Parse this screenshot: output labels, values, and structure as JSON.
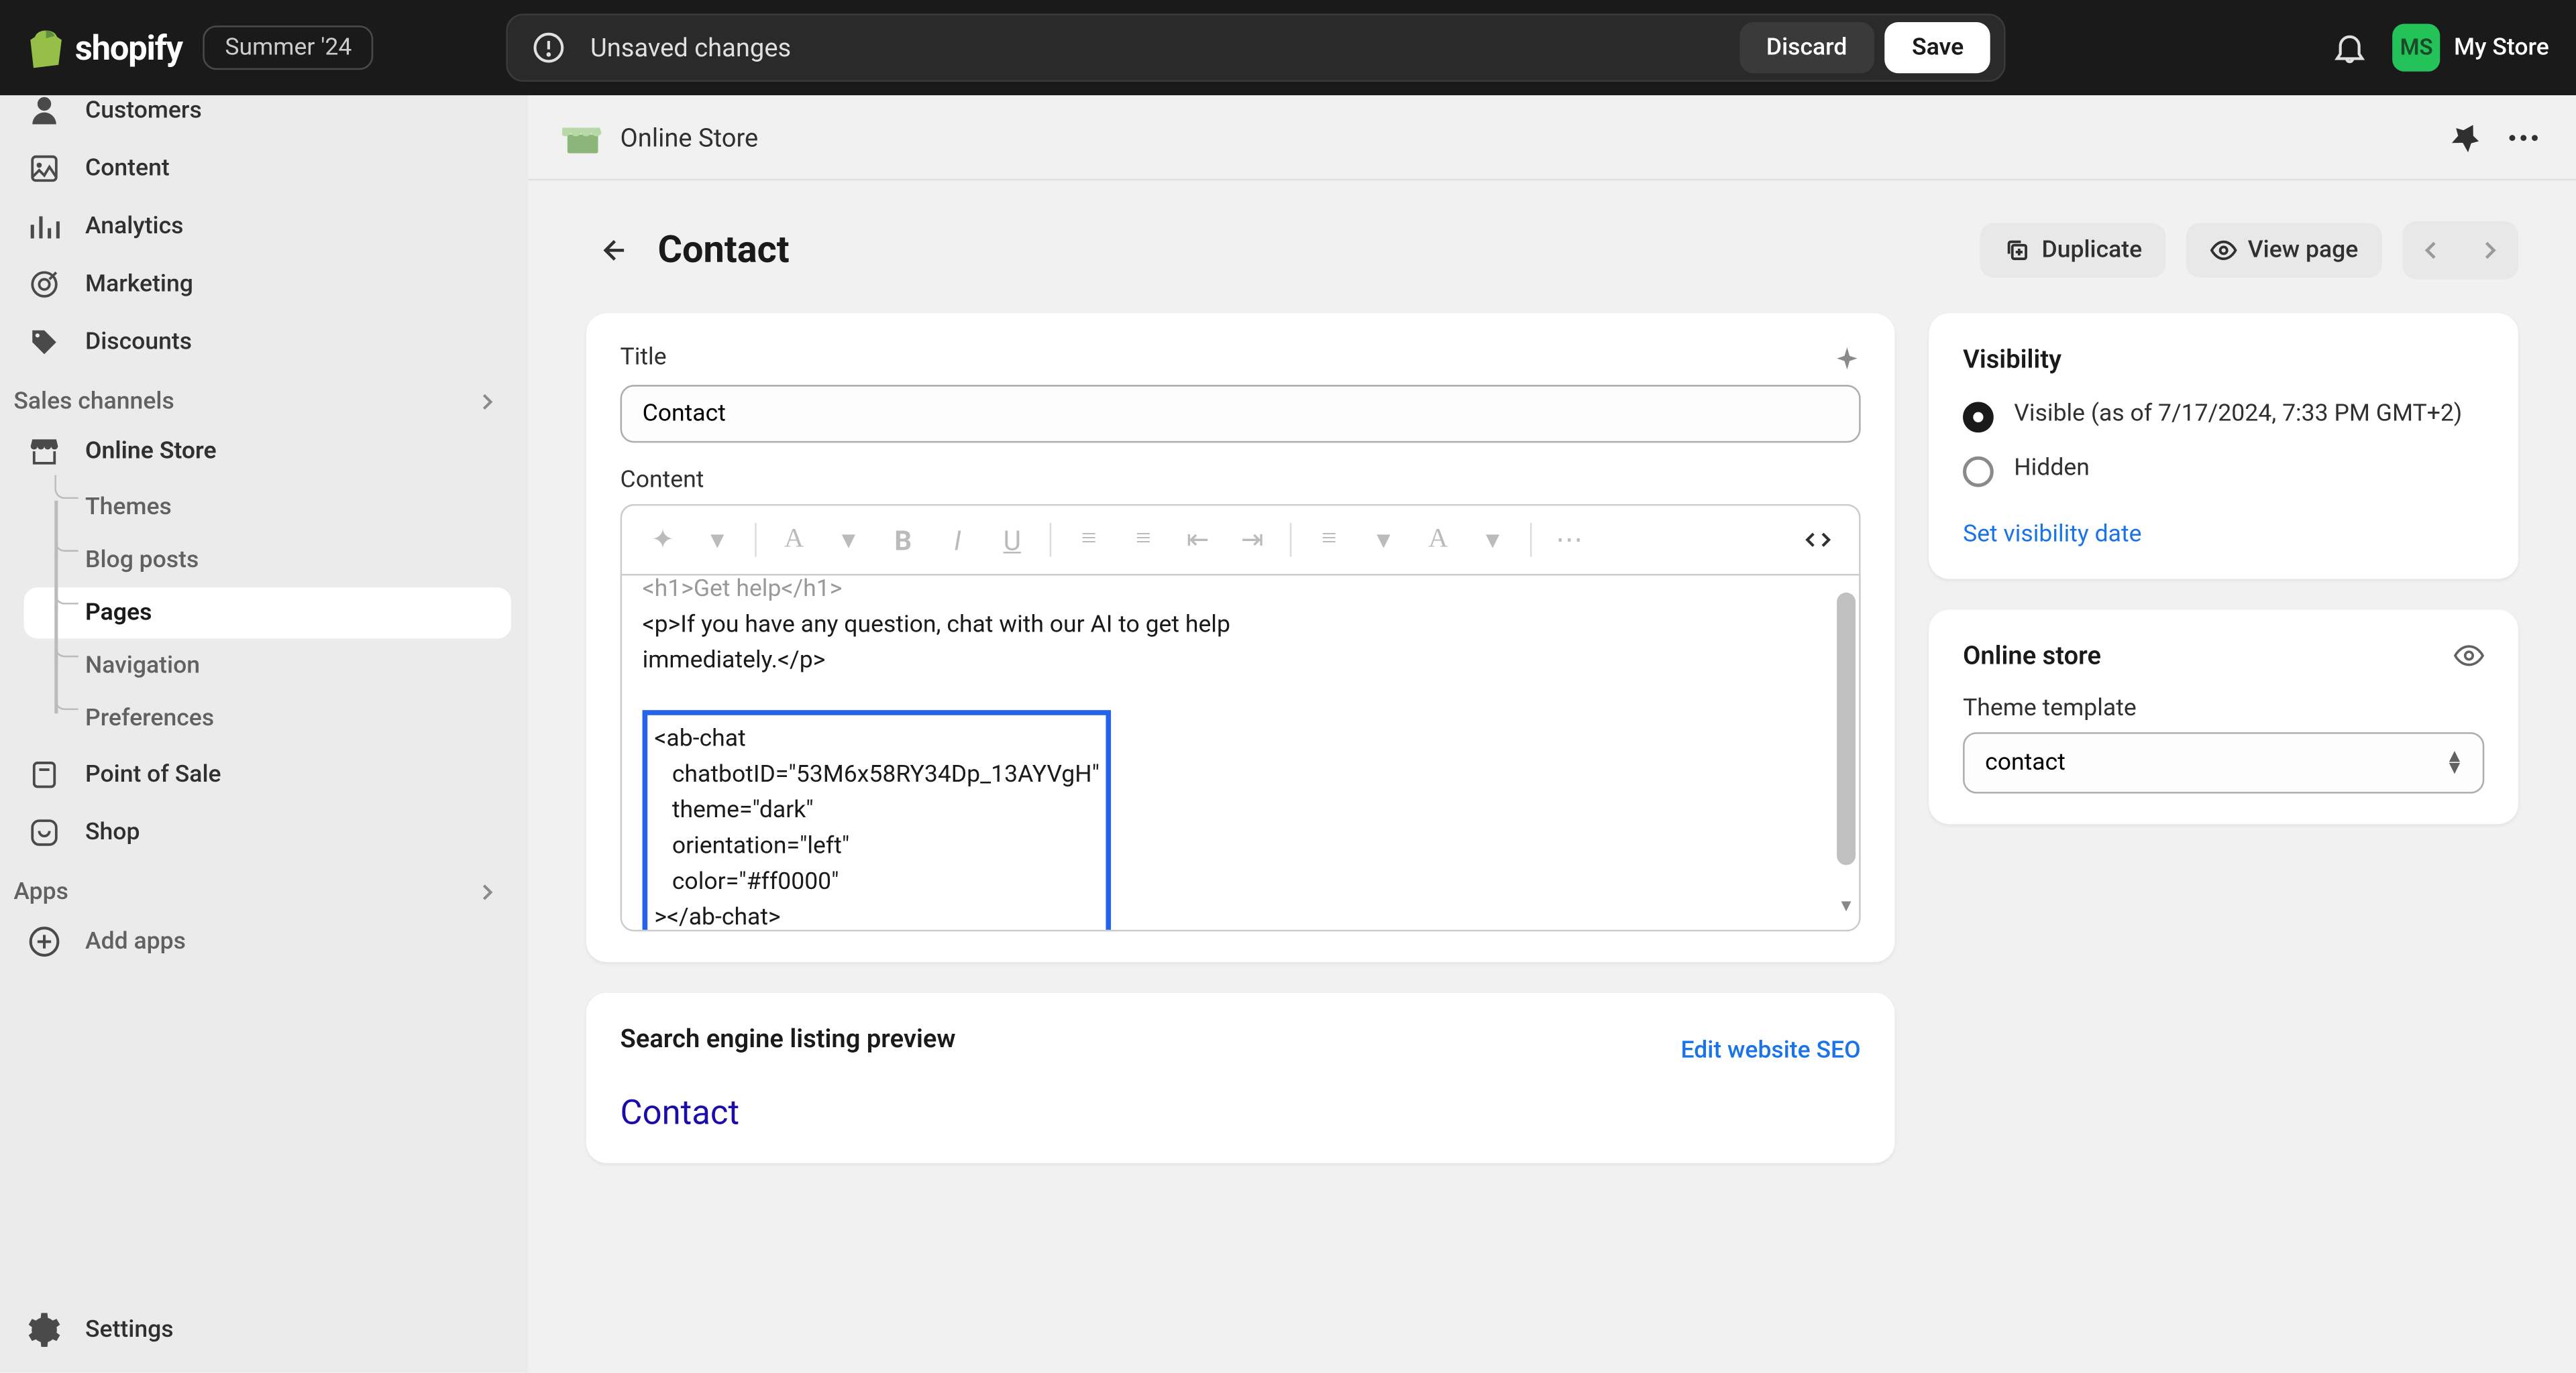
{
  "topbar": {
    "brand": "shopify",
    "badge": "Summer '24",
    "unsaved": "Unsaved changes",
    "discard": "Discard",
    "save": "Save",
    "avatar_initials": "MS",
    "store_name": "My Store"
  },
  "sidebar": {
    "items_top": [
      {
        "label": "Customers",
        "icon": "person",
        "partial": true
      },
      {
        "label": "Content",
        "icon": "image"
      },
      {
        "label": "Analytics",
        "icon": "bars"
      },
      {
        "label": "Marketing",
        "icon": "target"
      },
      {
        "label": "Discounts",
        "icon": "tag"
      }
    ],
    "sales_channels_header": "Sales channels",
    "online_store": "Online Store",
    "online_store_sub": [
      {
        "label": "Themes"
      },
      {
        "label": "Blog posts"
      },
      {
        "label": "Pages",
        "active": true
      },
      {
        "label": "Navigation"
      },
      {
        "label": "Preferences"
      }
    ],
    "pos": "Point of Sale",
    "shop": "Shop",
    "apps_header": "Apps",
    "add_apps": "Add apps",
    "settings": "Settings"
  },
  "header": {
    "store_label": "Online Store"
  },
  "page": {
    "title": "Contact",
    "duplicate": "Duplicate",
    "view_page": "View page"
  },
  "editor": {
    "title_label": "Title",
    "title_value": "Contact",
    "content_label": "Content",
    "code_lines": [
      "<h1>Get help</h1>",
      "<p>If you have any question, chat with our AI to get help",
      "immediately.</p>"
    ],
    "highlight_lines": [
      "<ab-chat",
      "   chatbotID=\"53M6x58RY34Dp_13AYVgH\"",
      "   theme=\"dark\"",
      "   orientation=\"left\"",
      "   color=\"#ff0000\"",
      "></ab-chat>"
    ]
  },
  "seo": {
    "heading": "Search engine listing preview",
    "edit": "Edit website SEO",
    "title": "Contact"
  },
  "visibility": {
    "heading": "Visibility",
    "visible_label": "Visible (as of 7/17/2024, 7:33 PM GMT+2)",
    "hidden_label": "Hidden",
    "set_date": "Set visibility date"
  },
  "online_store_card": {
    "heading": "Online store",
    "template_label": "Theme template",
    "template_value": "contact"
  }
}
